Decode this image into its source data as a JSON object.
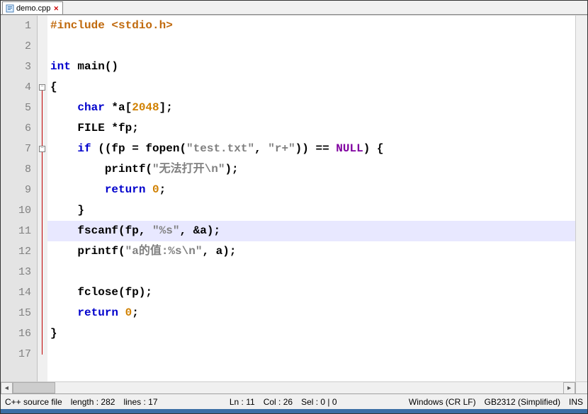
{
  "tab": {
    "filename": "demo.cpp"
  },
  "editor": {
    "lineHeight": 29,
    "lineCount": 17,
    "highlightLine": 11,
    "fold": {
      "start": 4,
      "sub": 7,
      "end": 17
    },
    "lines": [
      [
        [
          "dir",
          "#include <stdio.h>"
        ]
      ],
      [],
      [
        [
          "kw",
          "int"
        ],
        [
          "txt",
          " "
        ],
        [
          "fn",
          "main"
        ],
        [
          "txt",
          "()"
        ]
      ],
      [
        [
          "txt",
          "{"
        ]
      ],
      [
        [
          "txt",
          "    "
        ],
        [
          "kw",
          "char"
        ],
        [
          "txt",
          " *a["
        ],
        [
          "num",
          "2048"
        ],
        [
          "txt",
          "];"
        ]
      ],
      [
        [
          "txt",
          "    FILE *fp;"
        ]
      ],
      [
        [
          "txt",
          "    "
        ],
        [
          "kw",
          "if"
        ],
        [
          "txt",
          " ((fp = "
        ],
        [
          "fn",
          "fopen"
        ],
        [
          "txt",
          "("
        ],
        [
          "str",
          "\"test.txt\""
        ],
        [
          "txt",
          ", "
        ],
        [
          "str",
          "\"r+\""
        ],
        [
          "txt",
          ")) == "
        ],
        [
          "kw2",
          "NULL"
        ],
        [
          "txt",
          ") {"
        ]
      ],
      [
        [
          "txt",
          "        "
        ],
        [
          "fn",
          "printf"
        ],
        [
          "txt",
          "("
        ],
        [
          "str",
          "\"无法打开\\n\""
        ],
        [
          "txt",
          ");"
        ]
      ],
      [
        [
          "txt",
          "        "
        ],
        [
          "kw",
          "return"
        ],
        [
          "txt",
          " "
        ],
        [
          "num",
          "0"
        ],
        [
          "txt",
          ";"
        ]
      ],
      [
        [
          "txt",
          "    }"
        ]
      ],
      [
        [
          "txt",
          "    "
        ],
        [
          "fn",
          "fscanf"
        ],
        [
          "txt",
          "(fp, "
        ],
        [
          "str",
          "\"%s\""
        ],
        [
          "txt",
          ", &a);"
        ]
      ],
      [
        [
          "txt",
          "    "
        ],
        [
          "fn",
          "printf"
        ],
        [
          "txt",
          "("
        ],
        [
          "str",
          "\"a的值:%s\\n\""
        ],
        [
          "txt",
          ", a);"
        ]
      ],
      [],
      [
        [
          "txt",
          "    "
        ],
        [
          "fn",
          "fclose"
        ],
        [
          "txt",
          "(fp);"
        ]
      ],
      [
        [
          "txt",
          "    "
        ],
        [
          "kw",
          "return"
        ],
        [
          "txt",
          " "
        ],
        [
          "num",
          "0"
        ],
        [
          "txt",
          ";"
        ]
      ],
      [
        [
          "txt",
          "}"
        ]
      ],
      []
    ]
  },
  "status": {
    "lang": "C++ source file",
    "length_label": "length : ",
    "length_value": "282",
    "lines_label": "lines : ",
    "lines_value": "17",
    "ln_label": "Ln : ",
    "ln_value": "11",
    "col_label": "Col : ",
    "col_value": "26",
    "sel_label": "Sel : ",
    "sel_value": "0 | 0",
    "eol": "Windows (CR LF)",
    "encoding": "GB2312 (Simplified)",
    "mode": "INS"
  }
}
